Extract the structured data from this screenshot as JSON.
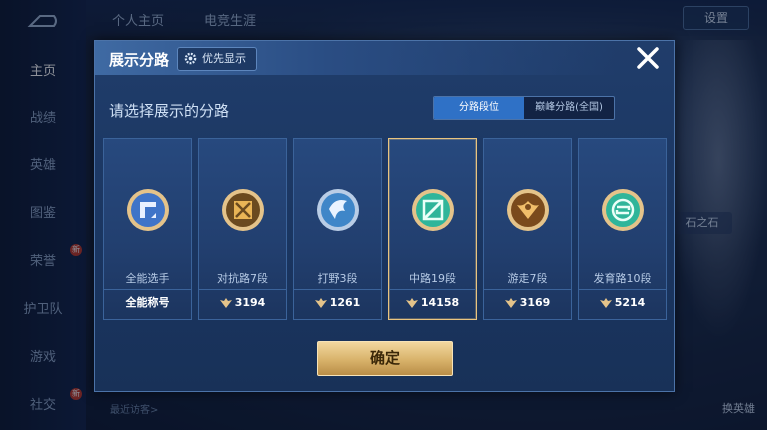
{
  "sidebar": {
    "items": [
      {
        "label": "主页",
        "active": true,
        "new": false
      },
      {
        "label": "战绩",
        "active": false,
        "new": false
      },
      {
        "label": "英雄",
        "active": false,
        "new": false
      },
      {
        "label": "图鉴",
        "active": false,
        "new": false
      },
      {
        "label": "荣誉",
        "active": false,
        "new": true
      },
      {
        "label": "护卫队",
        "active": false,
        "new": false
      },
      {
        "label": "游戏",
        "active": false,
        "new": false
      },
      {
        "label": "社交",
        "active": false,
        "new": true
      }
    ],
    "new_badge": "新"
  },
  "topbar": {
    "tabs": [
      "个人主页",
      "电竞生涯"
    ],
    "settings_label": "设置"
  },
  "background": {
    "recent_visitors": "最近访客>",
    "swap_hero": "换英雄",
    "stone_label": "石之石"
  },
  "modal": {
    "title": "展示分路",
    "priority_label": "优先显示",
    "prompt": "请选择展示的分路",
    "tabs": [
      {
        "label": "分路段位",
        "active": true
      },
      {
        "label": "巅峰分路(全国)",
        "active": false
      }
    ],
    "cards": [
      {
        "name": "全能选手",
        "score": "全能称号",
        "has_wing": false,
        "badge": "all-round-badge",
        "color": "#3f74c8",
        "selected": false
      },
      {
        "name": "对抗路7段",
        "score": "3194",
        "has_wing": true,
        "badge": "clash-lane-badge",
        "color": "#d59a3a",
        "selected": false
      },
      {
        "name": "打野3段",
        "score": "1261",
        "has_wing": true,
        "badge": "jungle-badge",
        "color": "#3f86c8",
        "selected": false
      },
      {
        "name": "中路19段",
        "score": "14158",
        "has_wing": true,
        "badge": "mid-lane-badge",
        "color": "#2fb59a",
        "selected": true
      },
      {
        "name": "游走7段",
        "score": "3169",
        "has_wing": true,
        "badge": "roam-badge",
        "color": "#d58a3a",
        "selected": false
      },
      {
        "name": "发育路10段",
        "score": "5214",
        "has_wing": true,
        "badge": "farm-lane-badge",
        "color": "#2fb59a",
        "selected": false
      }
    ],
    "confirm_label": "确定"
  }
}
